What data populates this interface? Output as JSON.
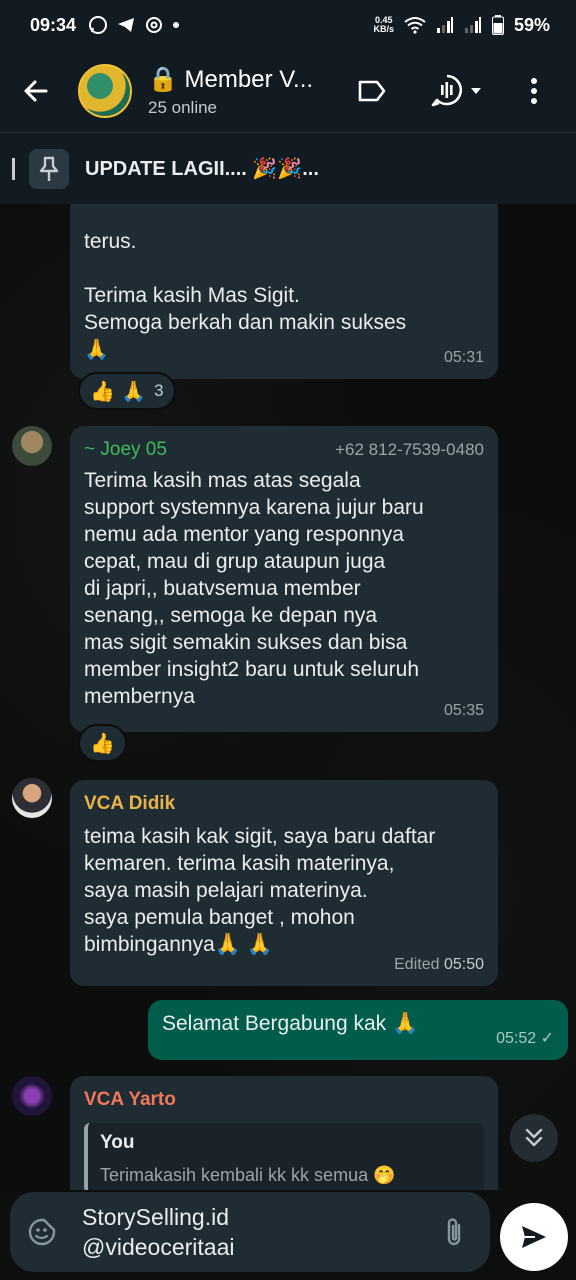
{
  "status_bar": {
    "time": "09:34",
    "net_speed_value": "0.45",
    "net_speed_unit": "KB/s",
    "battery": "59%"
  },
  "header": {
    "title": "🔒 Member V...",
    "subtitle": "25 online"
  },
  "pinned": {
    "text": "UPDATE LAGII.... 🎉🎉..."
  },
  "messages": {
    "m1": {
      "text_partial": "terus.",
      "text_1": "Terima kasih Mas Sigit.",
      "text_2": "Semoga berkah dan makin sukses",
      "text_3": "🙏",
      "time": "05:31",
      "reaction_emojis": "👍 🙏",
      "reaction_count": "3"
    },
    "m2": {
      "sender": "~ Joey 05",
      "phone": "+62 812-7539-0480",
      "lines": [
        "Terima kasih mas atas segala",
        "support systemnya karena jujur baru",
        "nemu ada mentor yang responnya",
        "cepat, mau di grup ataupun juga",
        "di japri,, buatvsemua member",
        "senang,,  semoga ke depan nya",
        "mas sigit semakin sukses dan bisa",
        "member insight2 baru untuk seluruh",
        "membernya"
      ],
      "time": "05:35",
      "reaction_emojis": "👍"
    },
    "m3": {
      "sender": "VCA Didik",
      "lines": [
        "teima kasih kak sigit, saya baru daftar",
        "kemaren. terima kasih materinya,",
        "saya masih pelajari materinya.",
        "saya pemula banget , mohon",
        "bimbingannya🙏 🙏"
      ],
      "edited": "Edited",
      "time": "05:50"
    },
    "m4": {
      "text": "Selamat Bergabung kak 🙏",
      "time": "05:52",
      "tick": "✓"
    },
    "m5": {
      "sender": "VCA Yarto",
      "quote_author": "You",
      "quote_text": "Terimakasih kembali kk kk semua 🤭"
    }
  },
  "composer": {
    "line_1": "StorySelling.id",
    "line_2": "@videoceritaai"
  },
  "colors": {
    "joey_name": "#3dbb5a",
    "didik_name": "#e8b44a",
    "yarto_name": "#f0785a",
    "outgoing_bubble": "#005c4b",
    "incoming_bubble": "#202c33"
  }
}
